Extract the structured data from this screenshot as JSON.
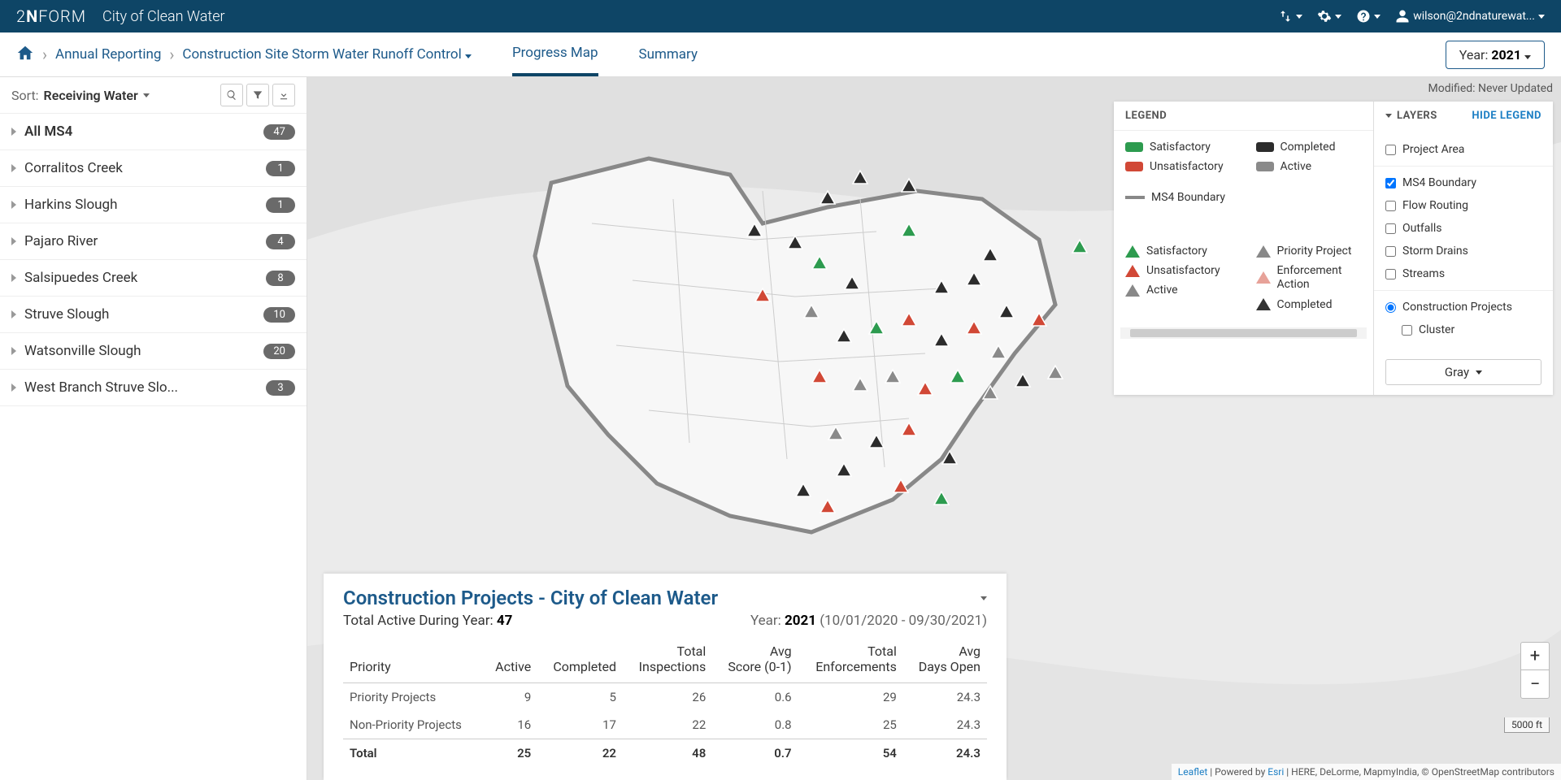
{
  "topbar": {
    "city": "City of Clean Water",
    "user": "wilson@2ndnaturewat..."
  },
  "breadcrumb": {
    "l1": "Annual Reporting",
    "l2": "Construction Site Storm Water Runoff Control"
  },
  "tabs": {
    "t1": "Progress Map",
    "t2": "Summary"
  },
  "year_btn": {
    "prefix": "Year: ",
    "year": "2021"
  },
  "sort": {
    "label": "Sort:",
    "value": "Receiving Water"
  },
  "list": [
    {
      "name": "All MS4",
      "count": "47",
      "bold": true
    },
    {
      "name": "Corralitos Creek",
      "count": "1"
    },
    {
      "name": "Harkins Slough",
      "count": "1"
    },
    {
      "name": "Pajaro River",
      "count": "4"
    },
    {
      "name": "Salsipuedes Creek",
      "count": "8"
    },
    {
      "name": "Struve Slough",
      "count": "10"
    },
    {
      "name": "Watsonville Slough",
      "count": "20"
    },
    {
      "name": "West Branch Struve Slo...",
      "count": "3"
    }
  ],
  "modified": "Modified: Never Updated",
  "legend": {
    "title": "LEGEND",
    "sat": "Satisfactory",
    "unsat": "Unsatisfactory",
    "comp": "Completed",
    "act": "Active",
    "ms4": "MS4 Boundary",
    "t_sat": "Satisfactory",
    "t_unsat": "Unsatisfactory",
    "t_act": "Active",
    "t_pp": "Priority Project",
    "t_enf": "Enforcement Action",
    "t_comp": "Completed"
  },
  "layers": {
    "title": "LAYERS",
    "hide": "HIDE LEGEND",
    "items": [
      {
        "label": "Project Area",
        "type": "checkbox",
        "checked": false
      },
      {
        "label": "MS4 Boundary",
        "type": "checkbox",
        "checked": true
      },
      {
        "label": "Flow Routing",
        "type": "checkbox",
        "checked": false
      },
      {
        "label": "Outfalls",
        "type": "checkbox",
        "checked": false
      },
      {
        "label": "Storm Drains",
        "type": "checkbox",
        "checked": false
      },
      {
        "label": "Streams",
        "type": "checkbox",
        "checked": false
      },
      {
        "label": "Construction Projects",
        "type": "radio",
        "checked": true
      },
      {
        "label": "Cluster",
        "type": "checkbox",
        "checked": false,
        "indent": true
      }
    ],
    "basemap": "Gray"
  },
  "panel": {
    "title": "Construction Projects - City of Clean Water",
    "total_label": "Total Active During Year: ",
    "total": "47",
    "year_label": "Year: ",
    "year": "2021",
    "range": " (10/01/2020 - 09/30/2021)",
    "cols": [
      "Priority",
      "Active",
      "Completed",
      "Total Inspections",
      "Avg Score (0-1)",
      "Total Enforcements",
      "Avg Days Open"
    ],
    "rows": [
      [
        "Priority Projects",
        "9",
        "5",
        "26",
        "0.6",
        "29",
        "24.3"
      ],
      [
        "Non-Priority Projects",
        "16",
        "17",
        "22",
        "0.8",
        "25",
        "24.3"
      ]
    ],
    "total_row": [
      "Total",
      "25",
      "22",
      "48",
      "0.7",
      "54",
      "24.3"
    ]
  },
  "zoom": {
    "scale": "5000 ft"
  },
  "attrib": {
    "leaflet": "Leaflet",
    "sep": " | Powered by ",
    "esri": "Esri",
    "rest": " | HERE, DeLorme, MapmyIndia, © OpenStreetMap contributors"
  },
  "colors": {
    "sat": "#2d9b4f",
    "unsat": "#d14836",
    "comp": "#2c2c2c",
    "act": "#8a8a8a"
  }
}
